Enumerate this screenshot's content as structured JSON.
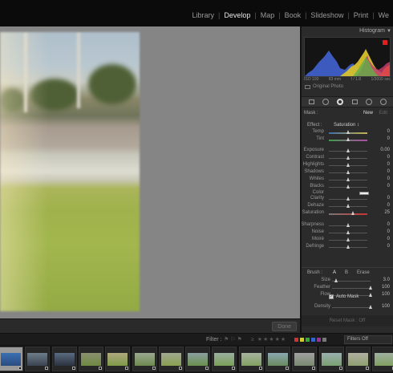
{
  "modules": [
    "Library",
    "Develop",
    "Map",
    "Book",
    "Slideshow",
    "Print",
    "We"
  ],
  "active_module": "Develop",
  "histogram": {
    "title": "Histogram",
    "info": [
      "ISO 100",
      "83 mm",
      "f / 1.8",
      "1/3000 sec"
    ],
    "original_photo": "Original Photo"
  },
  "mask": {
    "label": "Mask :",
    "new": "New",
    "edit": "Edit"
  },
  "effect": {
    "label": "Effect :",
    "value": "Saturation ↕"
  },
  "sliders": [
    {
      "label": "Temp",
      "value": "0",
      "pos": 0.5,
      "kind": "temp"
    },
    {
      "label": "Tint",
      "value": "0",
      "pos": 0.5,
      "kind": "tint"
    },
    {
      "label": "Exposure",
      "value": "0.00",
      "pos": 0.5,
      "kind": "plain"
    },
    {
      "label": "Contrast",
      "value": "0",
      "pos": 0.5,
      "kind": "plain"
    },
    {
      "label": "Highlights",
      "value": "0",
      "pos": 0.5,
      "kind": "plain"
    },
    {
      "label": "Shadows",
      "value": "0",
      "pos": 0.5,
      "kind": "plain"
    },
    {
      "label": "Whites",
      "value": "0",
      "pos": 0.5,
      "kind": "plain"
    },
    {
      "label": "Blacks",
      "value": "0",
      "pos": 0.5,
      "kind": "plain"
    },
    {
      "label": "Clarity",
      "value": "0",
      "pos": 0.5,
      "kind": "plain"
    },
    {
      "label": "Dehaze",
      "value": "0",
      "pos": 0.5,
      "kind": "plain"
    },
    {
      "label": "Saturation",
      "value": "25",
      "pos": 0.625,
      "kind": "sat"
    },
    {
      "label": "Sharpness",
      "value": "0",
      "pos": 0.5,
      "kind": "plain"
    },
    {
      "label": "Noise",
      "value": "0",
      "pos": 0.5,
      "kind": "plain"
    },
    {
      "label": "Moiré",
      "value": "0",
      "pos": 0.5,
      "kind": "plain"
    },
    {
      "label": "Defringe",
      "value": "0",
      "pos": 0.5,
      "kind": "plain"
    }
  ],
  "color_label": "Color",
  "brush": {
    "label": "Brush :",
    "a": "A",
    "b": "B",
    "erase": "Erase",
    "rows": [
      {
        "label": "Size",
        "value": "3.0",
        "pos": 0.12
      },
      {
        "label": "Feather",
        "value": "100",
        "pos": 1.0
      },
      {
        "label": "Flow",
        "value": "100",
        "pos": 1.0
      }
    ],
    "auto_mask": "Auto Mask",
    "density": {
      "label": "Density",
      "value": "100",
      "pos": 1.0
    }
  },
  "reset": "Reset Mask : Off",
  "toolbar": {
    "done": "Done"
  },
  "filter": {
    "label": "Filter :",
    "dropdown": "Filters Off"
  },
  "film_thumbs": 15
}
